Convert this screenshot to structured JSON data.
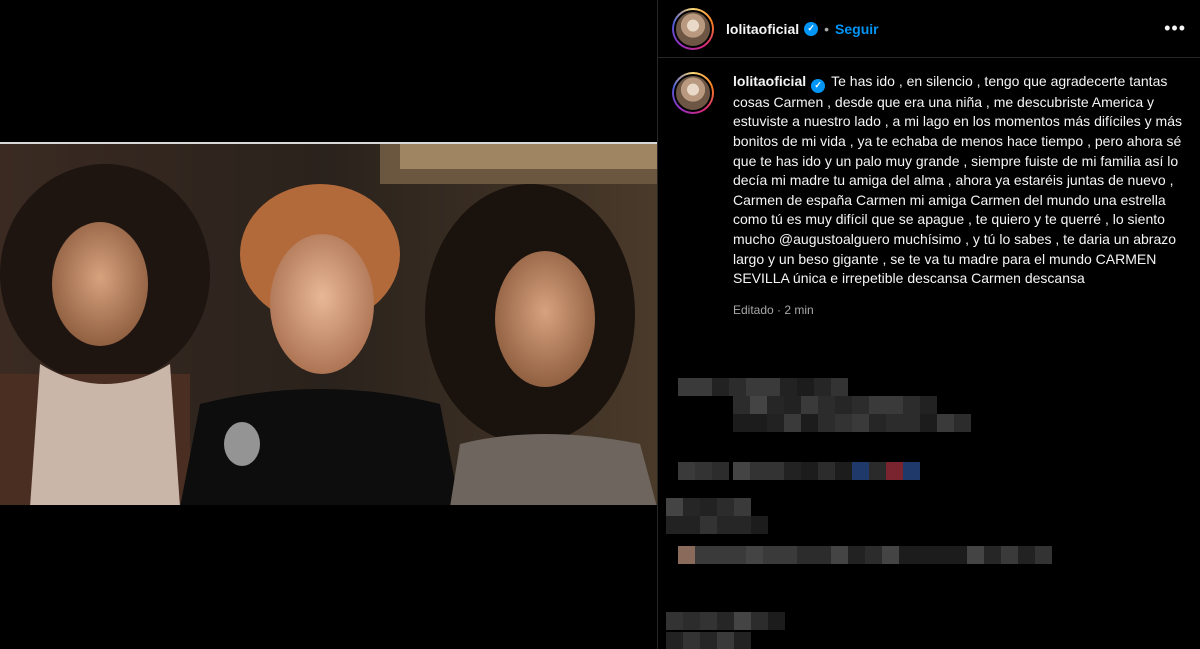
{
  "post": {
    "username": "lolitaoficial",
    "follow_label": "Seguir",
    "separator": "•",
    "more_label": "•••",
    "caption": "Te has ido , en silencio , tengo que agradecerte tantas cosas Carmen , desde que era una niña , me descubriste America y estuviste a nuestro lado , a mi lago en los momentos más difíciles y más bonitos de mi vida , ya te echaba de menos hace tiempo , pero ahora sé que te has ido y un palo muy grande , siempre fuiste de mi familia así lo decía mi madre tu amiga del alma , ahora ya estaréis juntas de nuevo , Carmen de españa Carmen mi amiga Carmen del mundo una estrella como tú es muy difícil que se apague , te quiero y te querré , lo siento mucho @augustoalguero muchísimo , y tú lo sabes , te daria un abrazo largo y un beso gigante , se te va tu madre para el mundo CARMEN SEVILLA única e irrepetible descansa Carmen descansa",
    "edited_label": "Editado · 2 min"
  },
  "icons": {
    "verified": "verified-badge-icon",
    "more": "more-options-icon"
  },
  "colors": {
    "background": "#000000",
    "link": "#0095f6",
    "text": "#f5f5f5",
    "muted": "#a8a8a8"
  }
}
